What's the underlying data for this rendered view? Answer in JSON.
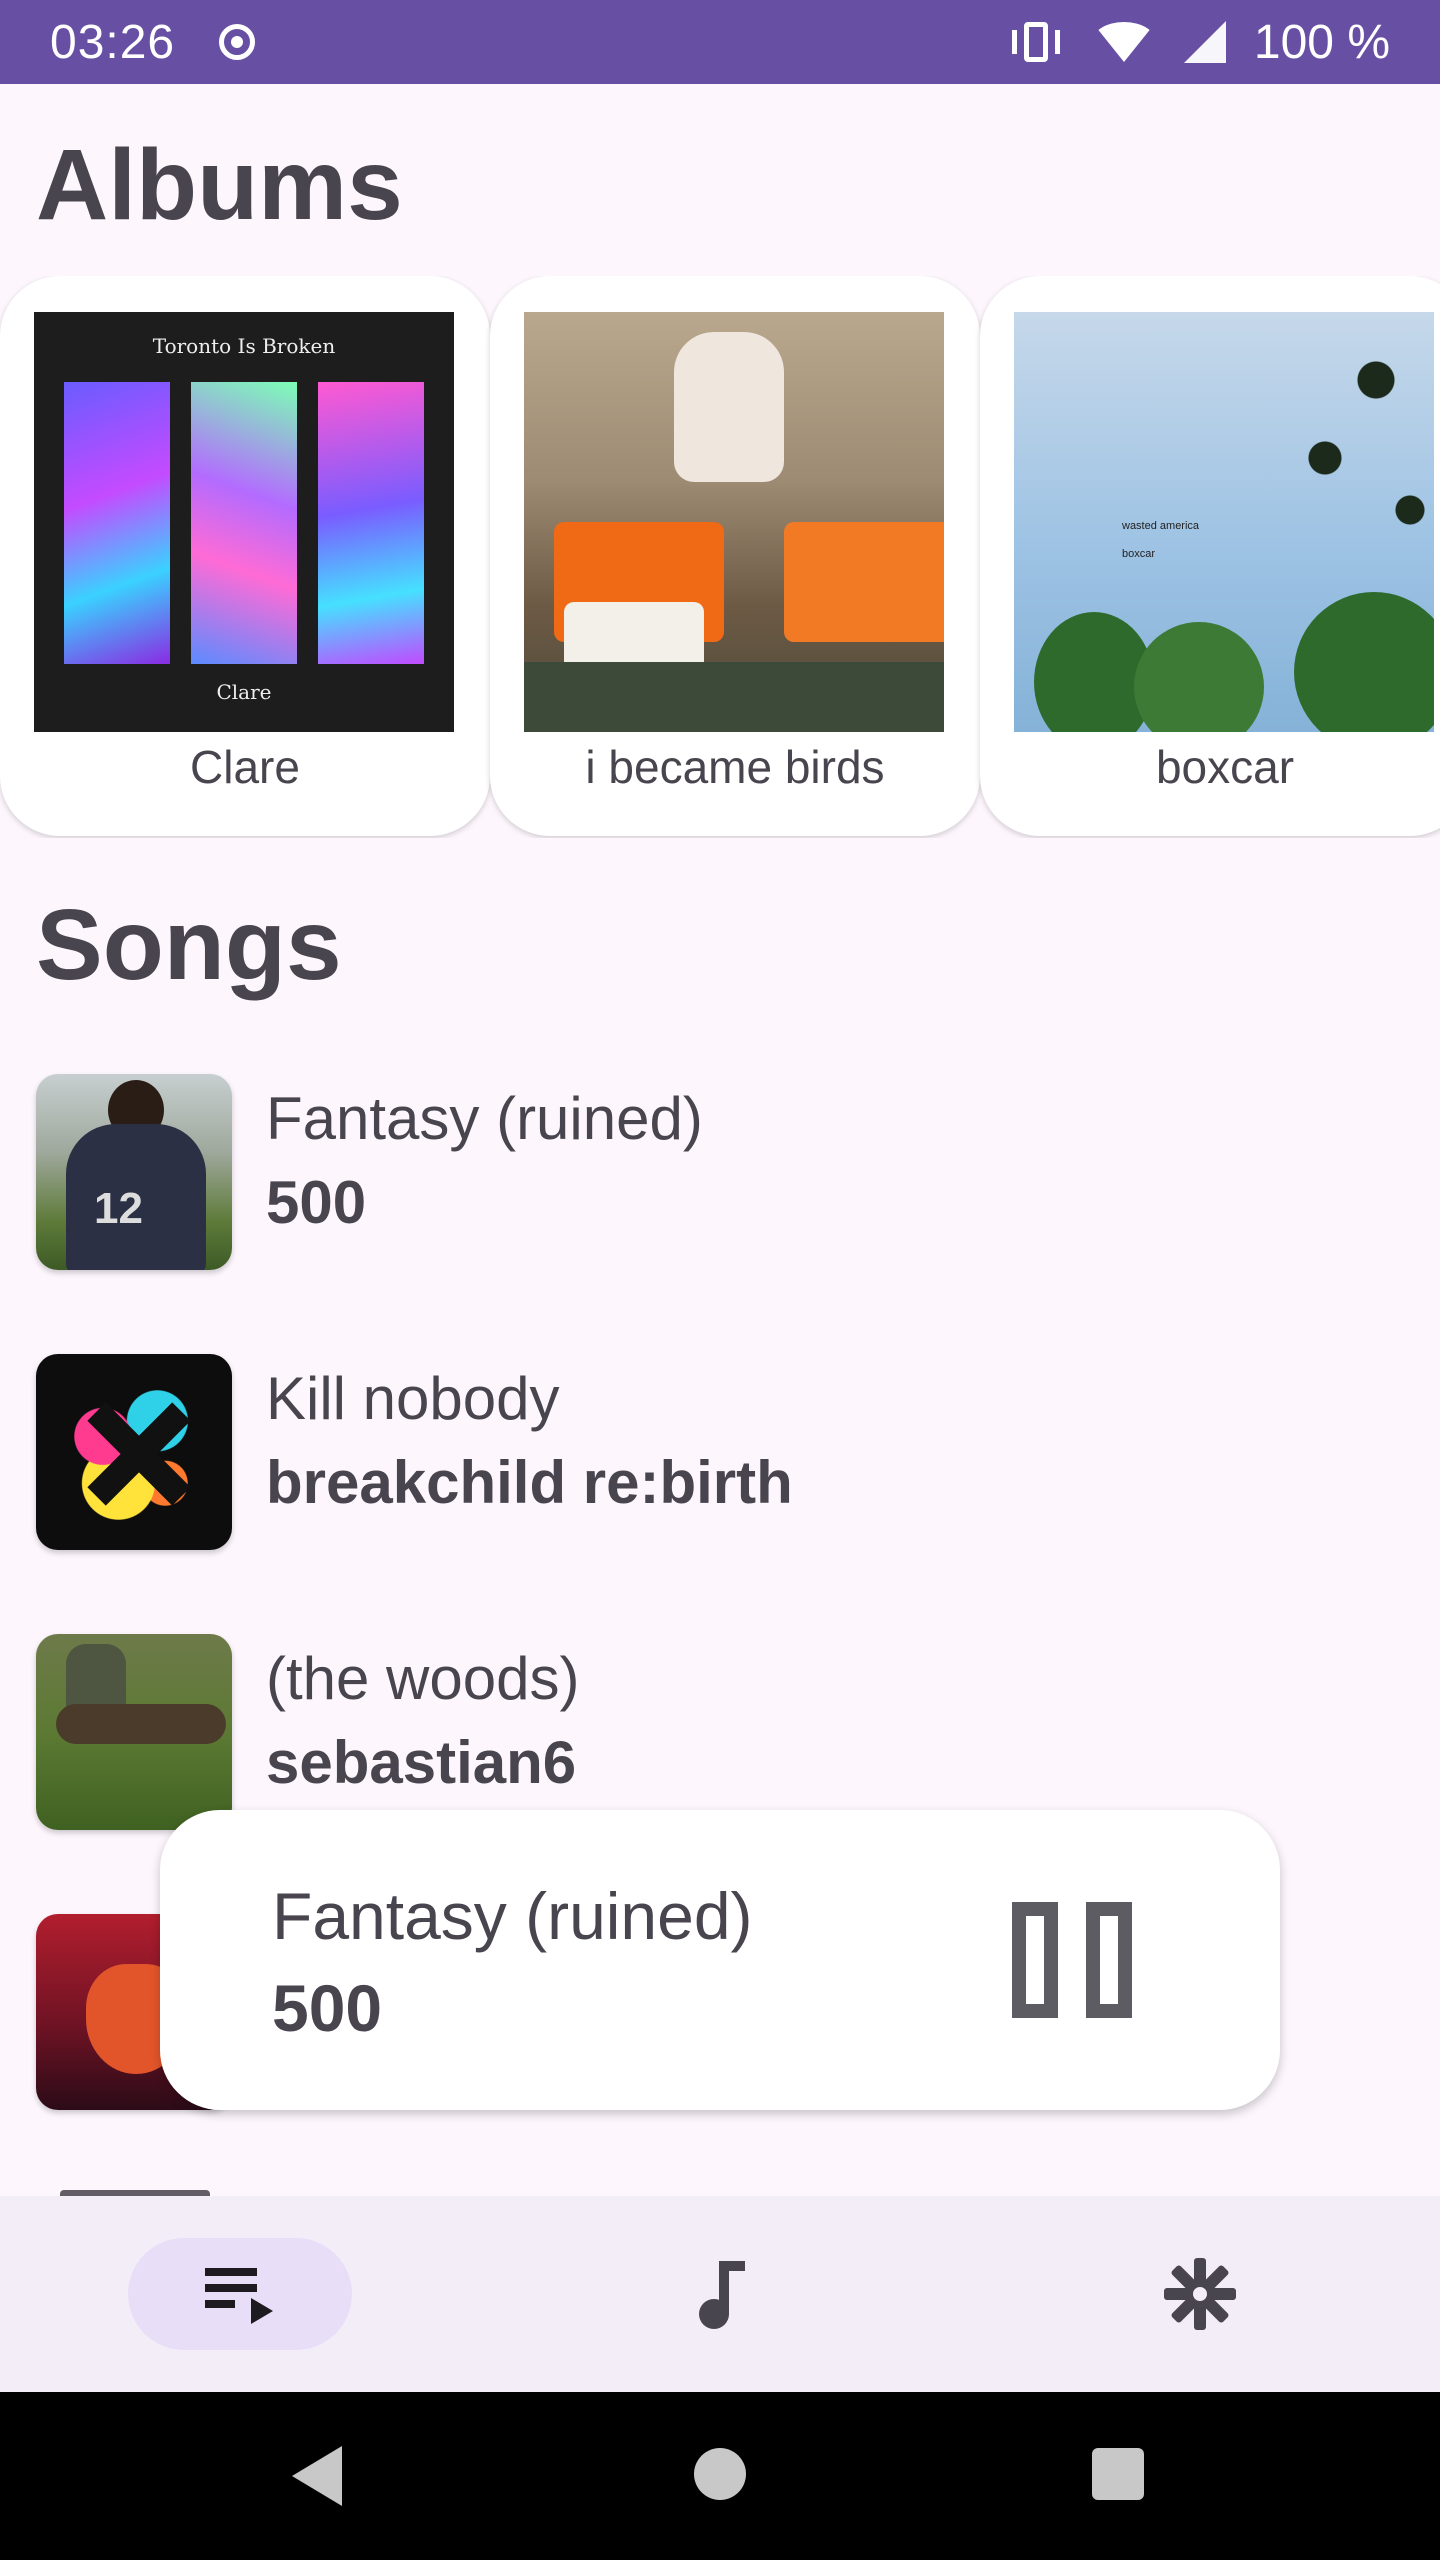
{
  "status_bar": {
    "time": "03:26",
    "battery": "100 %",
    "icons": [
      "record-icon",
      "vibrate-icon",
      "wifi-icon",
      "signal-icon"
    ],
    "background": "#6750a4"
  },
  "albums": {
    "title": "Albums",
    "items": [
      {
        "name": "Clare",
        "art_text_top": "Toronto Is Broken",
        "art_text_bottom": "Clare"
      },
      {
        "name": "i became birds"
      },
      {
        "name": "boxcar",
        "art_text_1": "wasted america",
        "art_text_2": "boxcar"
      }
    ]
  },
  "songs": {
    "title": "Songs",
    "items": [
      {
        "title": "Fantasy (ruined)",
        "artist": "500",
        "art_text": "12"
      },
      {
        "title": "Kill nobody",
        "artist": "breakchild re:birth"
      },
      {
        "title": "(the woods)",
        "artist": "sebastian6"
      },
      {
        "title": "",
        "artist": ""
      }
    ]
  },
  "now_playing": {
    "title": "Fantasy (ruined)",
    "artist": "500",
    "state": "playing",
    "control_icon": "pause-icon"
  },
  "bottom_nav": {
    "items": [
      {
        "icon": "queue-music-icon",
        "active": true
      },
      {
        "icon": "music-note-icon",
        "active": false
      },
      {
        "icon": "settings-gear-icon",
        "active": false
      }
    ],
    "active_color": "#e8def8"
  },
  "system_nav": {
    "icons": [
      "back-icon",
      "home-icon",
      "recents-icon"
    ]
  }
}
